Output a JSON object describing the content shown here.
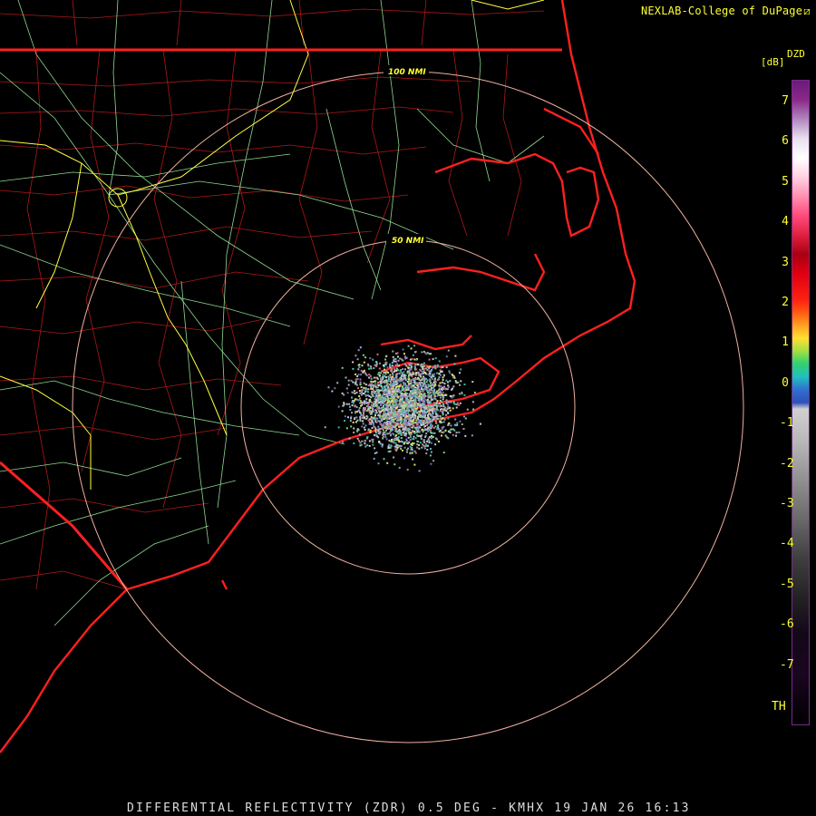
{
  "credit": {
    "text": "NEXLAB-College of DuPage",
    "mark": "⧄"
  },
  "product_line": "DIFFERENTIAL REFLECTIVITY (ZDR) 0.5 DEG - KMHX 19 JAN 26 16:13",
  "rings": [
    {
      "label": "50 NMI"
    },
    {
      "label": "100 NMI"
    }
  ],
  "legend": {
    "product_code": "DZD",
    "unit": "[dB]",
    "ticks": [
      "7",
      "6",
      "5",
      "4",
      "3",
      "2",
      "1",
      "0",
      "-1",
      "-2",
      "-3",
      "-4",
      "-5",
      "-6",
      "-7"
    ],
    "threshold_label": "TH"
  },
  "colors": {
    "background": "#000000",
    "state_borders": "#ff2020",
    "coastline": "#ff2020",
    "county_lines": "#b01818",
    "highways": "#90d890",
    "interstates": "#ffff40",
    "range_rings": "#f0b0a0",
    "text": "#ffff33"
  }
}
